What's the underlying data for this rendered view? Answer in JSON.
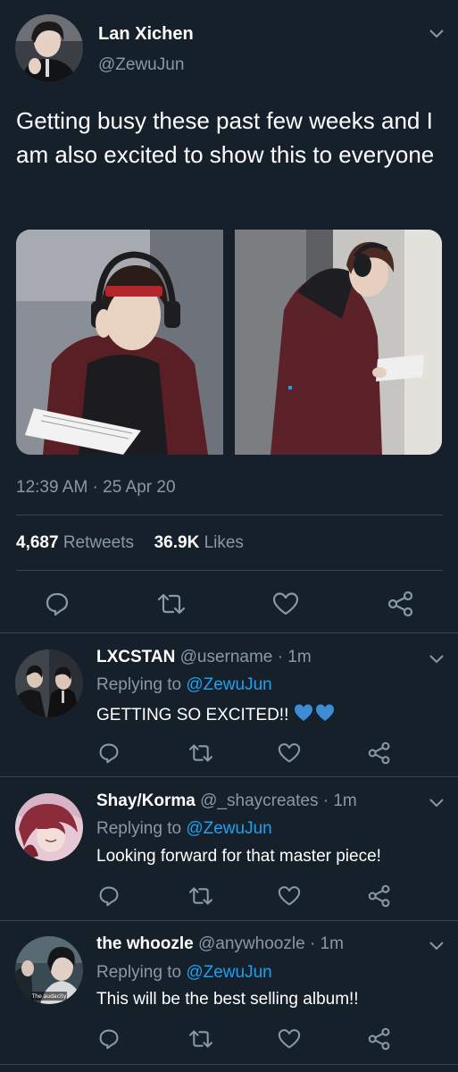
{
  "tweet": {
    "author_name": "Lan Xichen",
    "author_handle": "@ZewuJun",
    "text": "Getting busy these past few weeks and I am also excited to show this to everyone",
    "timestamp": "12:39 AM · 25 Apr 20",
    "retweets_count": "4,687",
    "retweets_label": "Retweets",
    "likes_count": "36.9K",
    "likes_label": "Likes"
  },
  "replies": [
    {
      "name": "LXCSTAN",
      "handle": "@username",
      "sep": "·",
      "time": "1m",
      "replying_prefix": "Replying to",
      "replying_to": "@ZewuJun",
      "text": "GETTING SO EXCITED!!",
      "emoji": "💙💙"
    },
    {
      "name": "Shay/Korma",
      "handle": "@_shaycreates",
      "sep": "·",
      "time": "1m",
      "replying_prefix": "Replying to",
      "replying_to": "@ZewuJun",
      "text": "Looking forward for that master piece!"
    },
    {
      "name": "the whoozle",
      "handle": "@anywhoozle",
      "sep": "·",
      "time": "1m",
      "replying_prefix": "Replying to",
      "replying_to": "@ZewuJun",
      "text": "This will be the best selling album!!",
      "avatar_caption": "The audacity"
    }
  ],
  "colors": {
    "background": "#15202b",
    "muted_text": "#8899a6",
    "link": "#1da1f2",
    "divider": "#38444d",
    "heart_emoji": "#3f8bd6"
  },
  "icons": [
    "chevron-down-icon",
    "reply-icon",
    "retweet-icon",
    "like-icon",
    "share-icon",
    "heart-emoji-icon"
  ]
}
